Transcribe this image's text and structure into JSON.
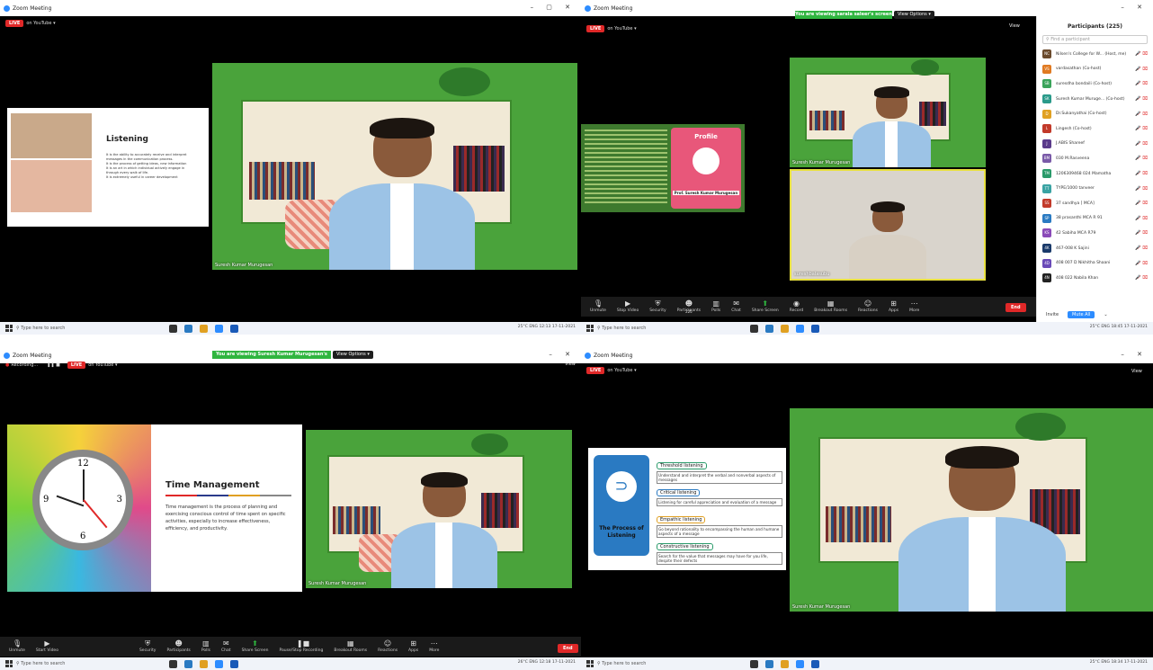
{
  "window_title": "Zoom Meeting",
  "live_label": "LIVE",
  "on_youtube": "on YouTube ▾",
  "q1": {
    "slide_title": "Listening",
    "slide_bullets": [
      "It is the ability to accurately receive and interpret",
      "messages in the communication process.",
      "It is the process of getting ideas, new information",
      "It is an art in which individual actively engage in",
      "through every walk of life.",
      "It is extremely useful in career development"
    ],
    "speaker_name": "Suresh Kumar Murugesan",
    "taskbar_search": "Type here to search",
    "tray": "25°C  ENG  12:13  17-11-2021"
  },
  "q2": {
    "banner": "You are viewing sarala saleer's screen",
    "view_options": "View Options ▾",
    "view": "View",
    "profile_title": "Profile",
    "profile_name": "Prof. Suresh Kumar Murugesan",
    "speaker_name": "Suresh Kumar Murugesan",
    "attendee_name": "sureshbalasubu",
    "toolbar": [
      "Unmute",
      "Stop Video",
      "Security",
      "Participants",
      "Polls",
      "Chat",
      "Share Screen",
      "Record",
      "Breakout Rooms",
      "Reactions",
      "Apps",
      "More"
    ],
    "participant_count": "225",
    "end": "End",
    "panel_title": "Participants (225)",
    "panel_search": "Find a participant",
    "participants": [
      {
        "initials": "NC",
        "name": "Nilsen's College for W... (Host, me)",
        "color": "#6b4a2c"
      },
      {
        "initials": "VS",
        "name": "vardasathan (Co-host)",
        "color": "#e07a22"
      },
      {
        "initials": "SB",
        "name": "suresdha bondaili (Co-host)",
        "color": "#3aa35a"
      },
      {
        "initials": "SK",
        "name": "Suresh Kumar Muruge... (Co-host)",
        "color": "#2a9a8a"
      },
      {
        "initials": "D",
        "name": "Dr.Sukanyathai (Co-host)",
        "color": "#e0a022"
      },
      {
        "initials": "L",
        "name": "Lingesh (Co-host)",
        "color": "#c23a2a"
      },
      {
        "initials": "J",
        "name": "J.ABIS Shareef",
        "color": "#5a3a8a"
      },
      {
        "initials": "BM",
        "name": "030 M.Rasveena",
        "color": "#7a5aa8"
      },
      {
        "initials": "TM",
        "name": "1206309468 024 Mamatha",
        "color": "#2a9a6a"
      },
      {
        "initials": "TT",
        "name": "TYPE/1000 tanveer",
        "color": "#3aa3a3"
      },
      {
        "initials": "SS",
        "name": "37 sandhya [ MCA]",
        "color": "#c23a2a"
      },
      {
        "initials": "SP",
        "name": "38 prasanthi MCA R 91",
        "color": "#2a7ac2"
      },
      {
        "initials": "KS",
        "name": "42 Sabiha MCA R79",
        "color": "#8a4ab8"
      },
      {
        "initials": "4K",
        "name": "467-008 K Sajini",
        "color": "#1a3a6a"
      },
      {
        "initials": "4D",
        "name": "408 007 D Nikhitha Shaani",
        "color": "#6a4ab8"
      },
      {
        "initials": "4N",
        "name": "408 022 Nabila Khan",
        "color": "#222"
      }
    ],
    "invite": "Invite",
    "mute_all": "Mute All",
    "taskbar_search": "Type here to search",
    "tray": "25°C  ENG  18:45  17-11-2021"
  },
  "q3": {
    "recording": "Recording...",
    "banner": "You are viewing Suresh Kumar Murugesan's screen",
    "view_options": "View Options ▾",
    "view": "View",
    "slide_title": "Time Management",
    "slide_text": "Time management is the process of planning and exercising conscious control of time spent on specific activities, especially to increase effectiveness, efficiency, and productivity.",
    "speaker_name": "Suresh Kumar Murugesan",
    "toolbar": [
      "Unmute",
      "Start Video",
      "Security",
      "Participants",
      "Polls",
      "Chat",
      "Share Screen",
      "Pause/Stop Recording",
      "Breakout Rooms",
      "Reactions",
      "Apps",
      "More"
    ],
    "end": "End",
    "taskbar_search": "Type here to search",
    "tray": "26°C  ENG  12:18  17-11-2021"
  },
  "q4": {
    "view": "View",
    "slide_left_title": "The Process of Listening",
    "steps": [
      {
        "title": "Threshold listening",
        "desc": "Understand and interpret the verbal and nonverbal aspects of messages"
      },
      {
        "title": "Critical listening",
        "desc": "Listening for careful appreciation and evaluation of a message"
      },
      {
        "title": "Empathic listening",
        "desc": "Go beyond rationality to encompassing the human and humane aspects of a message"
      },
      {
        "title": "Constructive listening",
        "desc": "Search for the value that messages may have for you life, despite their defects"
      }
    ],
    "speaker_name": "Suresh Kumar Murugesan",
    "taskbar_search": "Type here to search",
    "tray": "25°C  ENG  18:34  17-11-2021"
  }
}
